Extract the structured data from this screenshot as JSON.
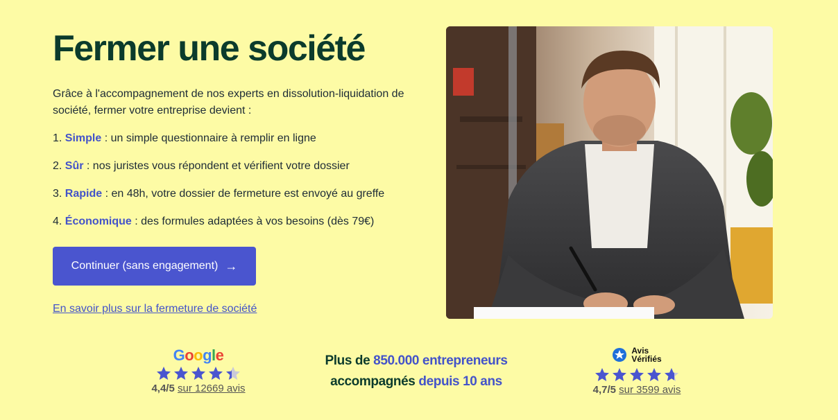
{
  "hero": {
    "title": "Fermer une société",
    "intro": "Grâce à l'accompagnement de nos experts en dissolution-liquidation de société, fermer votre entreprise devient :",
    "features": [
      {
        "prefix": "1. ",
        "keyword": "Simple",
        "text": " : un simple questionnaire à remplir en ligne"
      },
      {
        "prefix": "2. ",
        "keyword": "Sûr",
        "text": " : nos juristes vous répondent et vérifient votre dossier"
      },
      {
        "prefix": "3. ",
        "keyword": "Rapide",
        "text": " : en 48h, votre dossier de fermeture est envoyé au greffe"
      },
      {
        "prefix": "4. ",
        "keyword": "Économique",
        "text": " : des formules adaptées à vos besoins (dès 79€)"
      }
    ],
    "cta_label": "Continuer (sans engagement)",
    "cta_arrow": "→",
    "learn_more": "En savoir plus sur la fermeture de société"
  },
  "ratings": {
    "google": {
      "logo_letters": [
        "G",
        "o",
        "o",
        "g",
        "l",
        "e"
      ],
      "logo_colors": [
        "#4285F4",
        "#EA4335",
        "#FBBC05",
        "#4285F4",
        "#34A853",
        "#EA4335"
      ],
      "stars_value": 4.4,
      "score": "4,4/5",
      "reviews": "sur 12669 avis"
    },
    "middle": {
      "part1": "Plus de ",
      "highlight1": "850.000 entrepreneurs",
      "part2": "accompagnés ",
      "highlight2": "depuis 10 ans"
    },
    "avis": {
      "logo_line1": "Avis",
      "logo_line2": "Vérifiés",
      "stars_value": 4.7,
      "score": "4,7/5",
      "reviews": "sur 3599 avis"
    }
  },
  "colors": {
    "background": "#fdfba5",
    "accent": "#4a55cf",
    "title": "#0b3b2c",
    "star": "#4a55cf",
    "star_empty": "#c9c9d8"
  },
  "image": {
    "description_icon": "man-writing-photo"
  }
}
